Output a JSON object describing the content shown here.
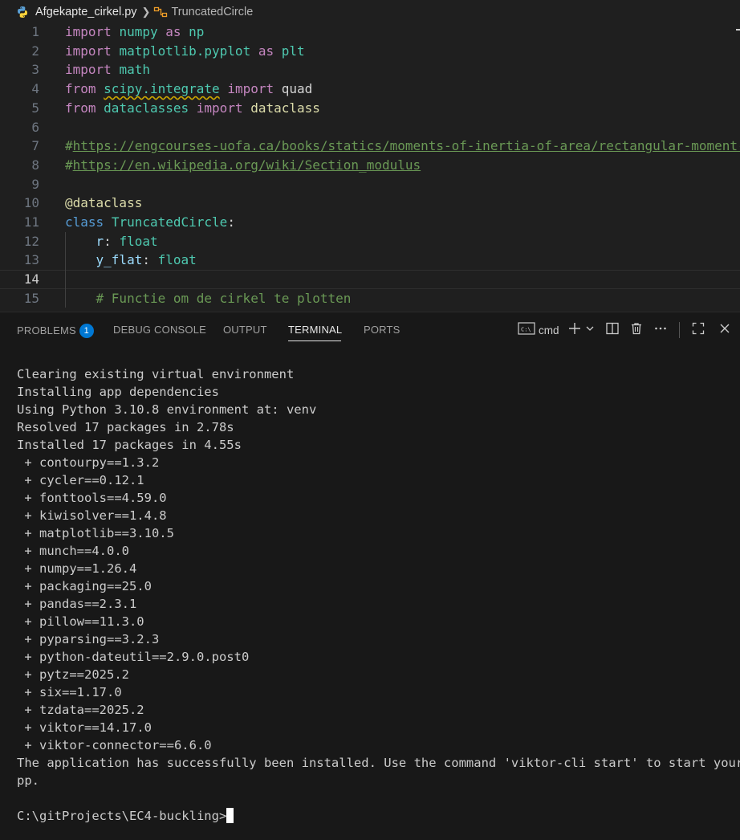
{
  "breadcrumb": {
    "file": "Afgekapte_cirkel.py",
    "symbol": "TruncatedCircle",
    "file_icon": "python-icon",
    "symbol_icon": "class-symbol-icon"
  },
  "editor": {
    "lines": [
      {
        "n": "1",
        "tokens": [
          [
            "kw",
            "import"
          ],
          [
            "plain",
            " "
          ],
          [
            "mod",
            "numpy"
          ],
          [
            "plain",
            " "
          ],
          [
            "kw",
            "as"
          ],
          [
            "plain",
            " "
          ],
          [
            "mod",
            "np"
          ]
        ]
      },
      {
        "n": "2",
        "tokens": [
          [
            "kw",
            "import"
          ],
          [
            "plain",
            " "
          ],
          [
            "mod",
            "matplotlib.pyplot"
          ],
          [
            "plain",
            " "
          ],
          [
            "kw",
            "as"
          ],
          [
            "plain",
            " "
          ],
          [
            "mod",
            "plt"
          ]
        ]
      },
      {
        "n": "3",
        "tokens": [
          [
            "kw",
            "import"
          ],
          [
            "plain",
            " "
          ],
          [
            "mod",
            "math"
          ]
        ]
      },
      {
        "n": "4",
        "tokens": [
          [
            "kw",
            "from"
          ],
          [
            "plain",
            " "
          ],
          [
            "mod squig",
            "scipy.integrate"
          ],
          [
            "plain",
            " "
          ],
          [
            "kw",
            "import"
          ],
          [
            "plain",
            " "
          ],
          [
            "plain",
            "quad"
          ]
        ]
      },
      {
        "n": "5",
        "tokens": [
          [
            "kw",
            "from"
          ],
          [
            "plain",
            " "
          ],
          [
            "mod",
            "dataclasses"
          ],
          [
            "plain",
            " "
          ],
          [
            "kw",
            "import"
          ],
          [
            "plain",
            " "
          ],
          [
            "fn",
            "dataclass"
          ]
        ]
      },
      {
        "n": "6",
        "tokens": []
      },
      {
        "n": "7",
        "tokens": [
          [
            "cmt",
            "#"
          ],
          [
            "link",
            "https://engcourses-uofa.ca/books/statics/moments-of-inertia-of-area/rectangular-moment-"
          ]
        ]
      },
      {
        "n": "8",
        "tokens": [
          [
            "cmt",
            "#"
          ],
          [
            "link",
            "https://en.wikipedia.org/wiki/Section_modulus"
          ]
        ]
      },
      {
        "n": "9",
        "tokens": []
      },
      {
        "n": "10",
        "tokens": [
          [
            "fn",
            "@dataclass"
          ]
        ]
      },
      {
        "n": "11",
        "tokens": [
          [
            "kw2",
            "class"
          ],
          [
            "plain",
            " "
          ],
          [
            "mod",
            "TruncatedCircle"
          ],
          [
            "plain",
            ":"
          ]
        ]
      },
      {
        "n": "12",
        "tokens": [
          [
            "plain",
            "    "
          ],
          [
            "id",
            "r"
          ],
          [
            "plain",
            ": "
          ],
          [
            "mod",
            "float"
          ]
        ]
      },
      {
        "n": "13",
        "tokens": [
          [
            "plain",
            "    "
          ],
          [
            "id",
            "y_flat"
          ],
          [
            "plain",
            ": "
          ],
          [
            "mod",
            "float"
          ]
        ]
      },
      {
        "n": "14",
        "tokens": [],
        "active": true
      },
      {
        "n": "15",
        "tokens": [
          [
            "plain",
            "    "
          ],
          [
            "cmt",
            "# Functie om de cirkel te plotten"
          ]
        ]
      }
    ]
  },
  "panel": {
    "tabs": [
      {
        "label": "PROBLEMS",
        "badge": "1"
      },
      {
        "label": "DEBUG CONSOLE"
      },
      {
        "label": "OUTPUT"
      },
      {
        "label": "TERMINAL",
        "active": true
      },
      {
        "label": "PORTS"
      }
    ],
    "terminal_profile": "cmd",
    "icons": [
      "terminal-cmd-icon",
      "plus-icon",
      "chevron-down-icon",
      "split-terminal-icon",
      "trash-icon",
      "more-icon",
      "maximize-icon",
      "close-icon"
    ]
  },
  "terminal": {
    "lines": [
      "Clearing existing virtual environment",
      "Installing app dependencies",
      "Using Python 3.10.8 environment at: venv",
      "Resolved 17 packages in 2.78s",
      "Installed 17 packages in 4.55s",
      " + contourpy==1.3.2",
      " + cycler==0.12.1",
      " + fonttools==4.59.0",
      " + kiwisolver==1.4.8",
      " + matplotlib==3.10.5",
      " + munch==4.0.0",
      " + numpy==1.26.4",
      " + packaging==25.0",
      " + pandas==2.3.1",
      " + pillow==11.3.0",
      " + pyparsing==3.2.3",
      " + python-dateutil==2.9.0.post0",
      " + pytz==2025.2",
      " + six==1.17.0",
      " + tzdata==2025.2",
      " + viktor==14.17.0",
      " + viktor-connector==6.6.0",
      "The application has successfully been installed. Use the command 'viktor-cli start' to start your a",
      "pp.",
      ""
    ],
    "prompt": "C:\\gitProjects\\EC4-buckling>"
  }
}
